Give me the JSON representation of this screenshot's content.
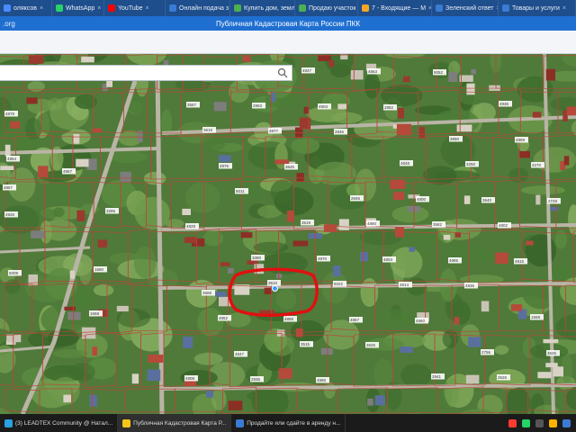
{
  "browser": {
    "tabs": [
      {
        "label": "оляксов",
        "color": "#4a8cff"
      },
      {
        "label": "WhatsApp",
        "color": "#25d366"
      },
      {
        "label": "YouTube",
        "color": "#ff0000"
      },
      {
        "label": "Онлайн подача з",
        "color": "#3b7bd4"
      },
      {
        "label": "Купить дом, земл",
        "color": "#4caf50"
      },
      {
        "label": "Продаю участок",
        "color": "#4caf50"
      },
      {
        "label": "7 - Входящие — М",
        "color": "#f5a623"
      },
      {
        "label": "Зеленский ответ",
        "color": "#3b7bd4"
      },
      {
        "label": "Товары и услуги",
        "color": "#3b7bd4"
      }
    ],
    "url_fragment": ".org",
    "page_title": "Публичная Кадастровая Карта России ПКК"
  },
  "search": {
    "placeholder": ""
  },
  "map": {
    "plot_labels": [
      "5146",
      "4979",
      "4947",
      "4863",
      "5052",
      "4936",
      "3567",
      "2963",
      "4903",
      "2882",
      "3990",
      "4959",
      "3618",
      "4877",
      "2846",
      "4848",
      "3250",
      "2270",
      "4976",
      "3620",
      "2846",
      "4800",
      "3640",
      "2749",
      "5011",
      "3519",
      "4880",
      "3582",
      "4802",
      "4828",
      "3390",
      "4970",
      "4803",
      "4985",
      "4915",
      "3688",
      "3610",
      "5022",
      "4914",
      "4935",
      "1658",
      "4952",
      "4855",
      "4867",
      "4860",
      "2756",
      "3526",
      "4847",
      "3515",
      "3625",
      "2941",
      "3526",
      "4808",
      "2936",
      "4985"
    ],
    "highlight_color": "#e01010"
  },
  "taskbar": {
    "items": [
      {
        "label": "(3) LEADTEX Community @ Натал...",
        "color": "#2aa1e0",
        "active": false
      },
      {
        "label": "Публичная Кадастровая Карта Р...",
        "color": "#f5c518",
        "active": true
      },
      {
        "label": "Продайте или сдайте в аренду н...",
        "color": "#3b7bd4",
        "active": false
      }
    ]
  }
}
